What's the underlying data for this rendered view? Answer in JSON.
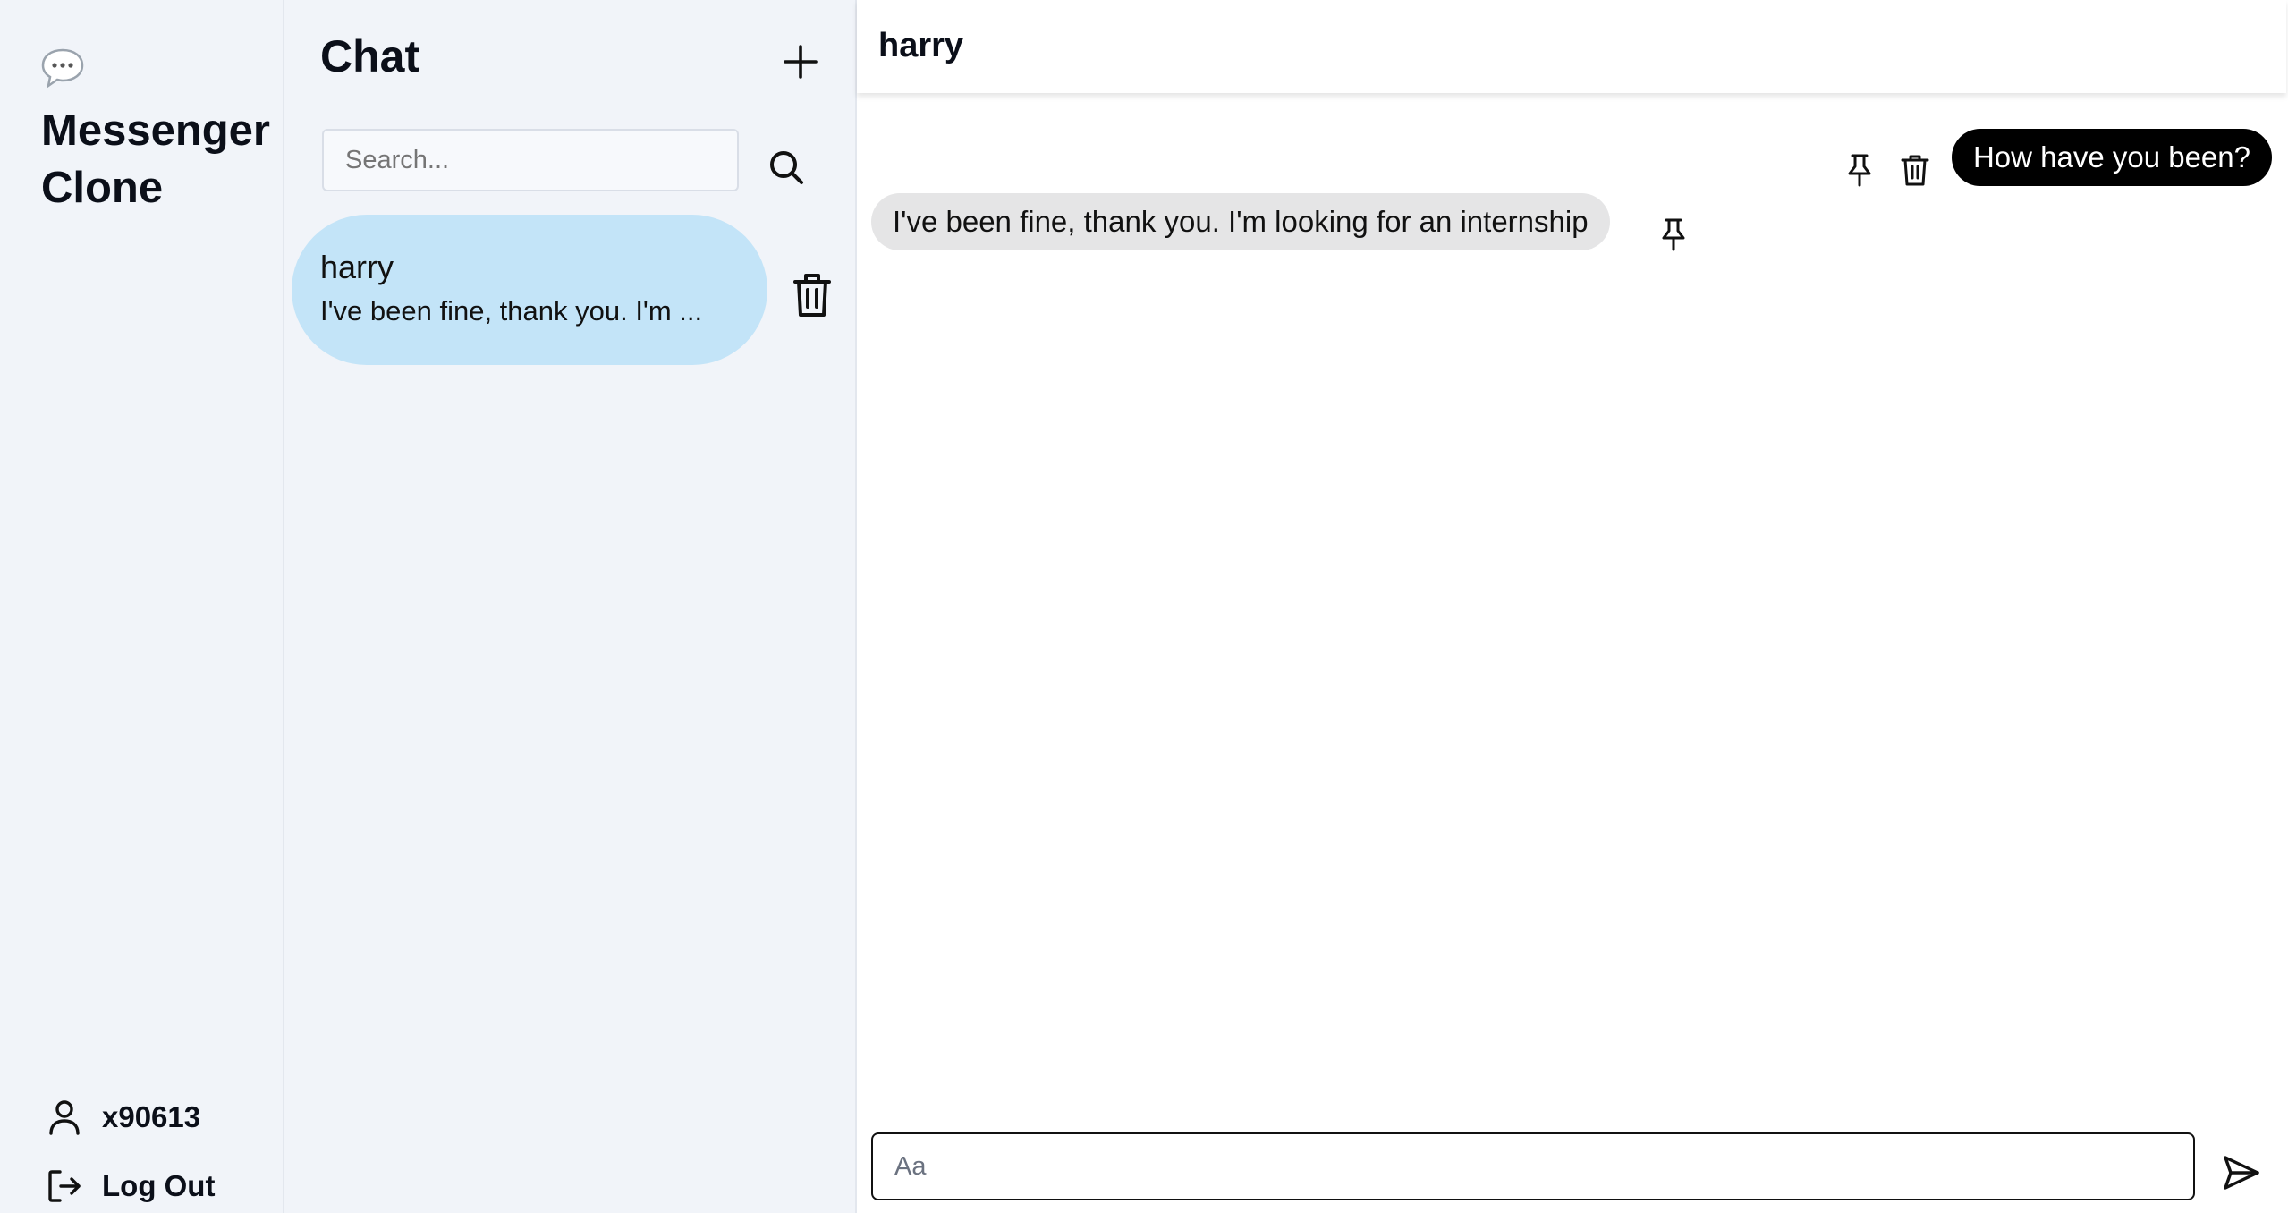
{
  "app": {
    "title": "Messenger Clone",
    "logo_icon": "speech-bubble-icon"
  },
  "nav": {
    "username": "x90613",
    "logout_label": "Log Out",
    "user_icon": "user-icon",
    "logout_icon": "logout-icon"
  },
  "chat_list": {
    "title": "Chat",
    "new_chat_icon": "plus-icon",
    "search_placeholder": "Search...",
    "search_icon": "search-icon",
    "conversations": [
      {
        "name": "harry",
        "preview": "I've been fine, thank you. I'm ...",
        "delete_icon": "trash-icon"
      }
    ]
  },
  "conversation": {
    "peer_name": "harry",
    "messages": [
      {
        "direction": "outgoing",
        "text": "How have you been?",
        "actions": [
          "pin-icon",
          "trash-icon"
        ]
      },
      {
        "direction": "incoming",
        "text": "I've been fine, thank you. I'm looking for an internship",
        "actions": [
          "pin-icon"
        ]
      }
    ],
    "composer_placeholder": "Aa",
    "send_icon": "send-icon"
  },
  "colors": {
    "sidebar_bg": "#f1f4f9",
    "selected_conversation_bg": "#c3e4f8",
    "outgoing_bubble": "#000000",
    "incoming_bubble": "#e5e5e6"
  }
}
